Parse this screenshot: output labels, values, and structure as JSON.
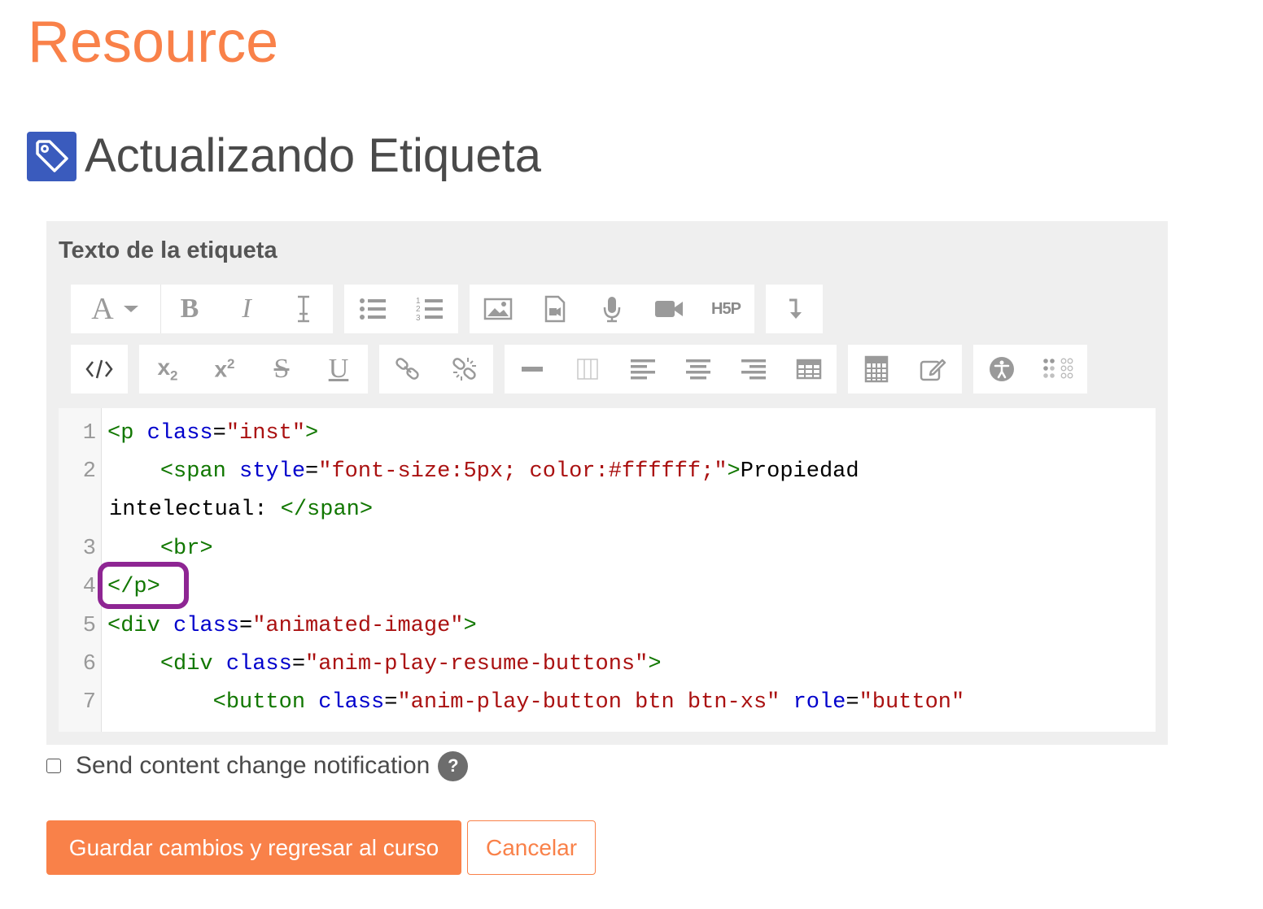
{
  "site": {
    "title": "Resource"
  },
  "page": {
    "heading": "Actualizando Etiqueta",
    "heading_icon": "tag-icon"
  },
  "editor": {
    "field_label": "Texto de la etiqueta",
    "toolbar_row1": [
      {
        "icon": "font-style-icon",
        "glyph": "A"
      },
      {
        "icon": "bold-icon",
        "glyph": "B"
      },
      {
        "icon": "italic-icon",
        "glyph": "I"
      },
      {
        "icon": "clear-formatting-icon"
      },
      {
        "icon": "unordered-list-icon"
      },
      {
        "icon": "ordered-list-icon"
      },
      {
        "icon": "image-icon"
      },
      {
        "icon": "media-icon"
      },
      {
        "icon": "record-audio-icon"
      },
      {
        "icon": "record-video-icon"
      },
      {
        "icon": "h5p-icon",
        "glyph": "H5P"
      },
      {
        "icon": "toolbar-toggle-icon"
      }
    ],
    "toolbar_row2": [
      {
        "icon": "html-source-icon"
      },
      {
        "icon": "subscript-icon",
        "glyph": "x",
        "sub": "2"
      },
      {
        "icon": "superscript-icon",
        "glyph": "x",
        "sup": "2"
      },
      {
        "icon": "strikethrough-icon",
        "glyph": "S"
      },
      {
        "icon": "underline-icon",
        "glyph": "U"
      },
      {
        "icon": "link-icon"
      },
      {
        "icon": "unlink-icon"
      },
      {
        "icon": "horizontal-rule-icon"
      },
      {
        "icon": "special-character-icon"
      },
      {
        "icon": "align-left-icon"
      },
      {
        "icon": "align-center-icon"
      },
      {
        "icon": "align-right-icon"
      },
      {
        "icon": "table-icon"
      },
      {
        "icon": "equation-icon"
      },
      {
        "icon": "edit-icon"
      },
      {
        "icon": "accessibility-checker-icon"
      },
      {
        "icon": "screenreader-helper-icon"
      }
    ],
    "code_lines": [
      {
        "num": "1",
        "tokens": [
          [
            "t",
            "<p"
          ],
          [
            "x",
            " "
          ],
          [
            "a",
            "class"
          ],
          [
            "x",
            "="
          ],
          [
            "s",
            "\"inst\""
          ],
          [
            "t",
            ">"
          ]
        ]
      },
      {
        "num": "2",
        "tokens": [
          [
            "x",
            "    "
          ],
          [
            "t",
            "<span"
          ],
          [
            "x",
            " "
          ],
          [
            "a",
            "style"
          ],
          [
            "x",
            "="
          ],
          [
            "s",
            "\"font-size:5px; color:#ffffff;\""
          ],
          [
            "t",
            ">"
          ],
          [
            "x",
            "Propiedad"
          ]
        ]
      },
      {
        "num": "",
        "tokens": [
          [
            "x",
            "intelectual: "
          ],
          [
            "t",
            "</span>"
          ]
        ]
      },
      {
        "num": "3",
        "tokens": [
          [
            "x",
            "    "
          ],
          [
            "t",
            "<br>"
          ]
        ]
      },
      {
        "num": "4",
        "tokens": [
          [
            "t",
            "</p>"
          ]
        ]
      },
      {
        "num": "5",
        "tokens": [
          [
            "t",
            "<div"
          ],
          [
            "x",
            " "
          ],
          [
            "a",
            "class"
          ],
          [
            "x",
            "="
          ],
          [
            "s",
            "\"animated-image\""
          ],
          [
            "t",
            ">"
          ]
        ]
      },
      {
        "num": "6",
        "tokens": [
          [
            "x",
            "    "
          ],
          [
            "t",
            "<div"
          ],
          [
            "x",
            " "
          ],
          [
            "a",
            "class"
          ],
          [
            "x",
            "="
          ],
          [
            "s",
            "\"anim-play-resume-buttons\""
          ],
          [
            "t",
            ">"
          ]
        ]
      },
      {
        "num": "7",
        "tokens": [
          [
            "x",
            "        "
          ],
          [
            "t",
            "<button"
          ],
          [
            "x",
            " "
          ],
          [
            "a",
            "class"
          ],
          [
            "x",
            "="
          ],
          [
            "s",
            "\"anim-play-button btn btn-xs\""
          ],
          [
            "x",
            " "
          ],
          [
            "a",
            "role"
          ],
          [
            "x",
            "="
          ],
          [
            "s",
            "\"button\""
          ]
        ]
      }
    ]
  },
  "form": {
    "notify_label": "Send content change notification",
    "help_glyph": "?",
    "save_label": "Guardar cambios y regresar al curso",
    "cancel_label": "Cancelar"
  },
  "colors": {
    "brand": "#f98149",
    "tag_badge": "#3a5bbd",
    "highlight": "#8e2593"
  }
}
